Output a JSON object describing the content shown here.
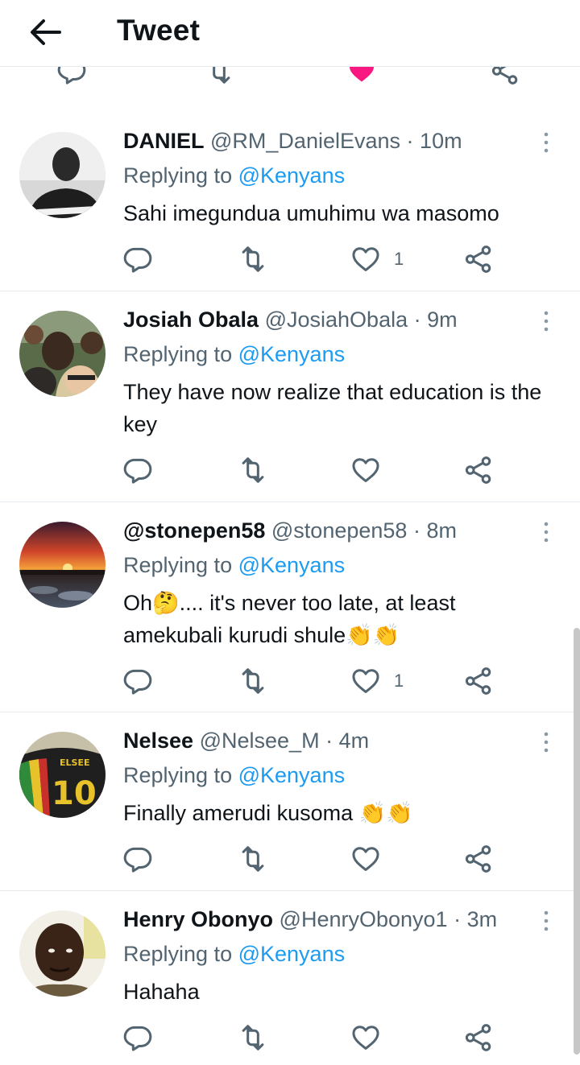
{
  "header": {
    "title": "Tweet",
    "back_icon": "arrow-left-icon"
  },
  "colors": {
    "mention": "#1d9bf0",
    "secondary": "#536471",
    "like_active": "#f91880"
  },
  "replies": [
    {
      "name": "DANIEL",
      "handle": "@RM_DanielEvans",
      "dot": "·",
      "time": "10m",
      "replying_label": "Replying to",
      "mention": "@Kenyans",
      "text": "Sahi imegundua umuhimu wa masomo",
      "like_count": "1"
    },
    {
      "name": "Josiah Obala",
      "handle": "@JosiahObala",
      "dot": "·",
      "time": "9m",
      "replying_label": "Replying to",
      "mention": "@Kenyans",
      "text": "They have now realize that education is the key",
      "like_count": ""
    },
    {
      "name": "@stonepen58",
      "handle": "@stonepen58",
      "dot": "·",
      "time": "8m",
      "replying_label": "Replying to",
      "mention": "@Kenyans",
      "text": "Oh🤔.... it's never too late, at least amekubali kurudi shule👏👏",
      "like_count": "1"
    },
    {
      "name": "Nelsee",
      "handle": "@Nelsee_M",
      "dot": "·",
      "time": "4m",
      "replying_label": "Replying to",
      "mention": "@Kenyans",
      "text": "Finally amerudi kusoma 👏👏",
      "like_count": ""
    },
    {
      "name": "Henry Obonyo",
      "handle": "@HenryObonyo1",
      "dot": "·",
      "time": "3m",
      "replying_label": "Replying to",
      "mention": "@Kenyans",
      "text": "Hahaha",
      "like_count": ""
    }
  ]
}
